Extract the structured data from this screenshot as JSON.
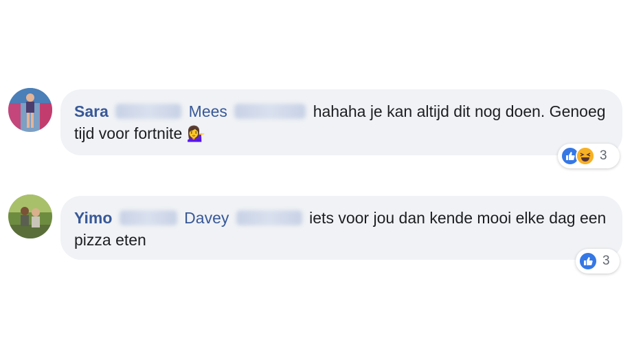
{
  "comments": [
    {
      "author": "Sara",
      "tagged": "Mees",
      "text": "hahaha je kan altijd dit nog doen. Genoeg tijd voor fortnite",
      "emoji": "💁‍♀️",
      "reactions": [
        "like-icon",
        "haha-icon"
      ],
      "reaction_count": "3"
    },
    {
      "author": "Yimo",
      "tagged": "Davey",
      "text": "iets voor jou dan kende mooi elke dag een pizza eten",
      "emoji": "",
      "reactions": [
        "like-icon"
      ],
      "reaction_count": "3"
    }
  ],
  "colors": {
    "name": "#385898",
    "bubble": "#f0f2f5",
    "like": "#3578e5",
    "haha": "#f7b125"
  }
}
